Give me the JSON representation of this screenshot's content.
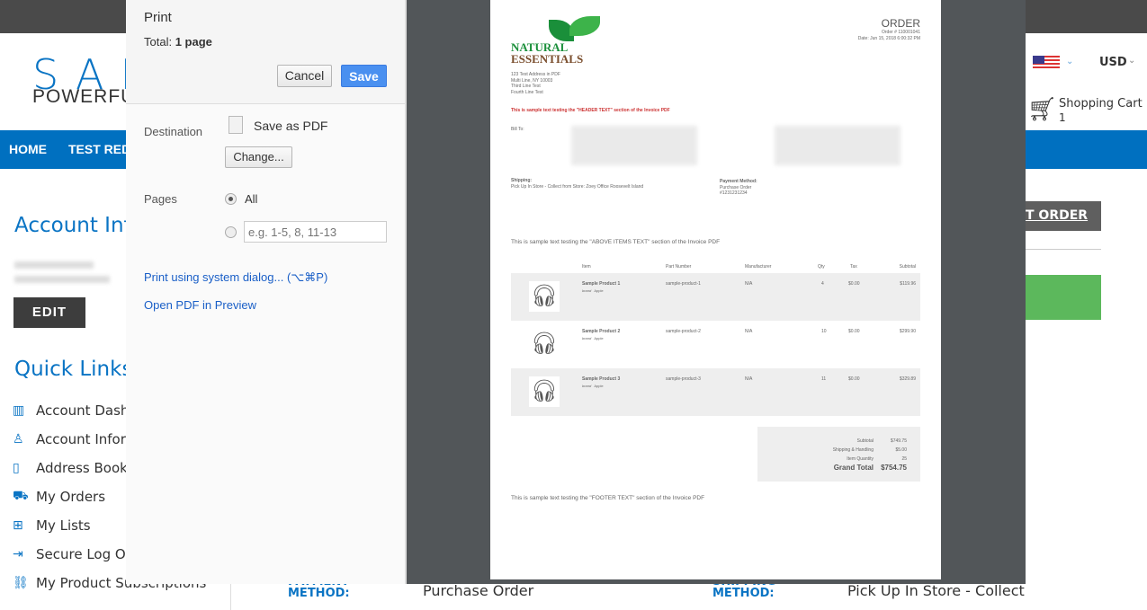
{
  "site": {
    "logo_top": "SAN",
    "logo_bottom": "POWERFUL",
    "nav": [
      "HOME",
      "TEST RED"
    ],
    "account_title": "Account Inf",
    "edit": "EDIT",
    "quick_links_title": "Quick Links",
    "quick_links": [
      {
        "label": "Account Dash",
        "icon": "chart-icon"
      },
      {
        "label": "Account Infor",
        "icon": "user-icon"
      },
      {
        "label": "Address Book",
        "icon": "book-icon"
      },
      {
        "label": "My Orders",
        "icon": "cart-icon"
      },
      {
        "label": "My Lists",
        "icon": "gift-icon"
      },
      {
        "label": "Secure Log O",
        "icon": "logout-icon"
      },
      {
        "label": "My Product Subscriptions",
        "icon": "link-icon"
      }
    ],
    "currency": "USD",
    "cart_label": "Shopping Cart",
    "cart_count": "1",
    "order_button": "T ORDER",
    "payment_label_1": "PAYMENT",
    "payment_label_2": "METHOD:",
    "payment_value": "Purchase Order",
    "shipping_label_1": "SHIPPING",
    "shipping_label_2": "METHOD:",
    "shipping_value": "Pick Up In Store - Collect",
    "colors": {
      "brand": "#0070c0",
      "green": "#5cb85c"
    }
  },
  "dialog": {
    "title": "Print",
    "total_label": "Total:",
    "total_value": "1 page",
    "cancel": "Cancel",
    "save": "Save",
    "destination_label": "Destination",
    "destination_value": "Save as PDF",
    "change": "Change...",
    "pages_label": "Pages",
    "pages_all": "All",
    "pages_placeholder": "e.g. 1-5, 8, 11-13",
    "system_dialog": "Print using system dialog... (⌥⌘P)",
    "open_preview": "Open PDF in Preview"
  },
  "invoice": {
    "logo_1": "NATURAL",
    "logo_2": "ESSENTIALS",
    "title": "ORDER",
    "order_no": "Order # 110001041",
    "date": "Date: Jun 15, 2018 6:00:32 PM",
    "address": [
      "123 Test Address in PDF",
      "Multi Line, NY 10003",
      "Third Line Test",
      "Fourth Line Test"
    ],
    "header_text": "This is sample text testing the \"HEADER TEXT\" section of the Invoice PDF",
    "bill_to": "Bill To:",
    "shipping_label": "Shipping:",
    "shipping_value": "Pick Up In Store - Collect from Store: Zoey Office Roosevelt Island",
    "payment_label": "Payment Method:",
    "payment_value": "Purchase Order",
    "payment_ref": "#1231231234",
    "above_items": "This is sample text testing the \"ABOVE ITEMS TEXT\" section of the Invoice PDF",
    "columns": [
      "Item",
      "Part Number",
      "Manufacturer",
      "Qty",
      "Tax",
      "Subtotal"
    ],
    "items": [
      {
        "name": "Sample Product 1",
        "brand_label": "brand",
        "brand": "Apple",
        "part": "sample-product-1",
        "mfr": "N/A",
        "qty": "4",
        "tax": "$0.00",
        "subtotal": "$119.96"
      },
      {
        "name": "Sample Product 2",
        "brand_label": "brand",
        "brand": "Apple",
        "part": "sample-product-2",
        "mfr": "N/A",
        "qty": "10",
        "tax": "$0.00",
        "subtotal": "$299.90"
      },
      {
        "name": "Sample Product 3",
        "brand_label": "brand",
        "brand": "Apple",
        "part": "sample-product-3",
        "mfr": "N/A",
        "qty": "11",
        "tax": "$0.00",
        "subtotal": "$329.89"
      }
    ],
    "totals": [
      {
        "label": "Subtotal",
        "value": "$749.75"
      },
      {
        "label": "Shipping & Handling",
        "value": "$5.00"
      },
      {
        "label": "Item Quantity",
        "value": "25"
      }
    ],
    "grand_total_label": "Grand Total",
    "grand_total": "$754.75",
    "footer_text": "This is sample text testing the \"FOOTER TEXT\" section of the Invoice PDF"
  }
}
